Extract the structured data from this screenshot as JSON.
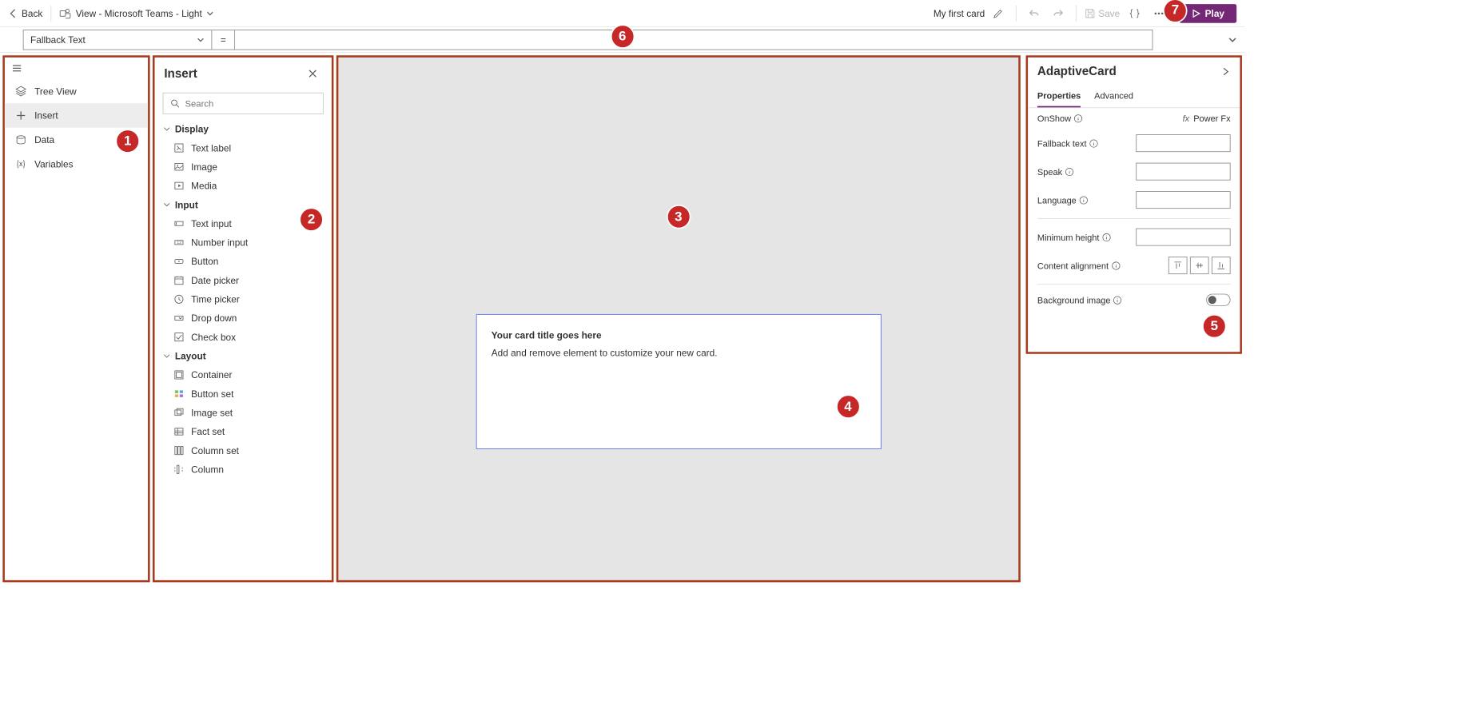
{
  "topbar": {
    "back": "Back",
    "view_label": "View - Microsoft Teams - Light",
    "card_name": "My first card",
    "save": "Save",
    "play": "Play"
  },
  "formula_bar": {
    "property": "Fallback Text",
    "eq": "=",
    "value": ""
  },
  "left_nav": {
    "items": [
      {
        "label": "Tree View"
      },
      {
        "label": "Insert"
      },
      {
        "label": "Data"
      },
      {
        "label": "Variables"
      }
    ]
  },
  "insert_panel": {
    "title": "Insert",
    "search_ph": "Search",
    "groups": [
      {
        "name": "Display",
        "items": [
          "Text label",
          "Image",
          "Media"
        ]
      },
      {
        "name": "Input",
        "items": [
          "Text input",
          "Number input",
          "Button",
          "Date picker",
          "Time picker",
          "Drop down",
          "Check box"
        ]
      },
      {
        "name": "Layout",
        "items": [
          "Container",
          "Button set",
          "Image set",
          "Fact set",
          "Column set",
          "Column"
        ]
      }
    ]
  },
  "canvas": {
    "card_title": "Your card title goes here",
    "card_sub": "Add and remove element to customize your new card."
  },
  "properties": {
    "title": "AdaptiveCard",
    "tabs": [
      "Properties",
      "Advanced"
    ],
    "onshow_label": "OnShow",
    "powerfx_label": "Power Fx",
    "rows": {
      "fallback": "Fallback text",
      "speak": "Speak",
      "language": "Language",
      "minheight": "Minimum height",
      "contentalign": "Content alignment",
      "bgimage": "Background image"
    }
  },
  "callouts": [
    "1",
    "2",
    "3",
    "4",
    "5",
    "6",
    "7"
  ]
}
